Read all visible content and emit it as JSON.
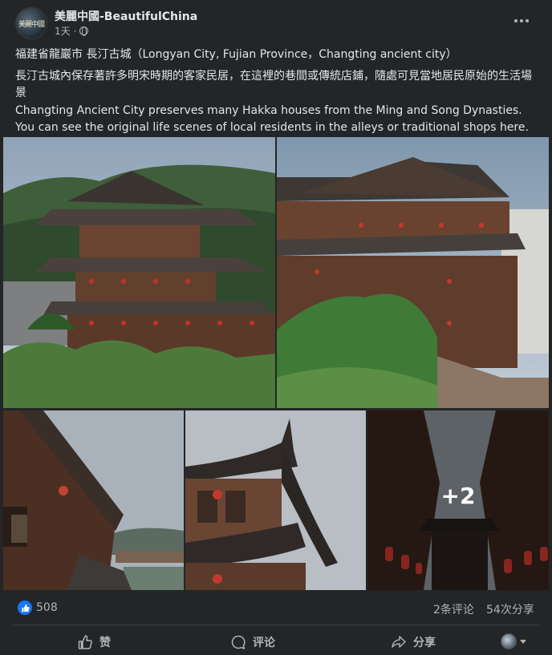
{
  "post": {
    "page_name": "美麗中國-BeautifulChina",
    "avatar_text": "美麗中國",
    "time": "1天",
    "separator": "·",
    "location_line": "福建省龍巖市 長汀古城（Longyan City, Fujian Province，Changting ancient city）",
    "text_zh": "長汀古城內保存著許多明宋時期的客家民居，在這裡的巷間或傳統店鋪，隨處可見當地居民原始的生活場景",
    "text_en": "Changting Ancient City preserves many Hakka houses from the Ming and Song Dynasties. You can see the original life scenes of local residents in the alleys or traditional shops here."
  },
  "photos": {
    "more_count": "+2"
  },
  "stats": {
    "likes": "508",
    "comments": "2条评论",
    "shares": "54次分享"
  },
  "actions": {
    "like": "赞",
    "comment": "评论",
    "share": "分享"
  },
  "colors": {
    "background": "#242526",
    "text_primary": "#e4e6eb",
    "text_secondary": "#b0b3b8",
    "like_blue": "#1877f2"
  }
}
